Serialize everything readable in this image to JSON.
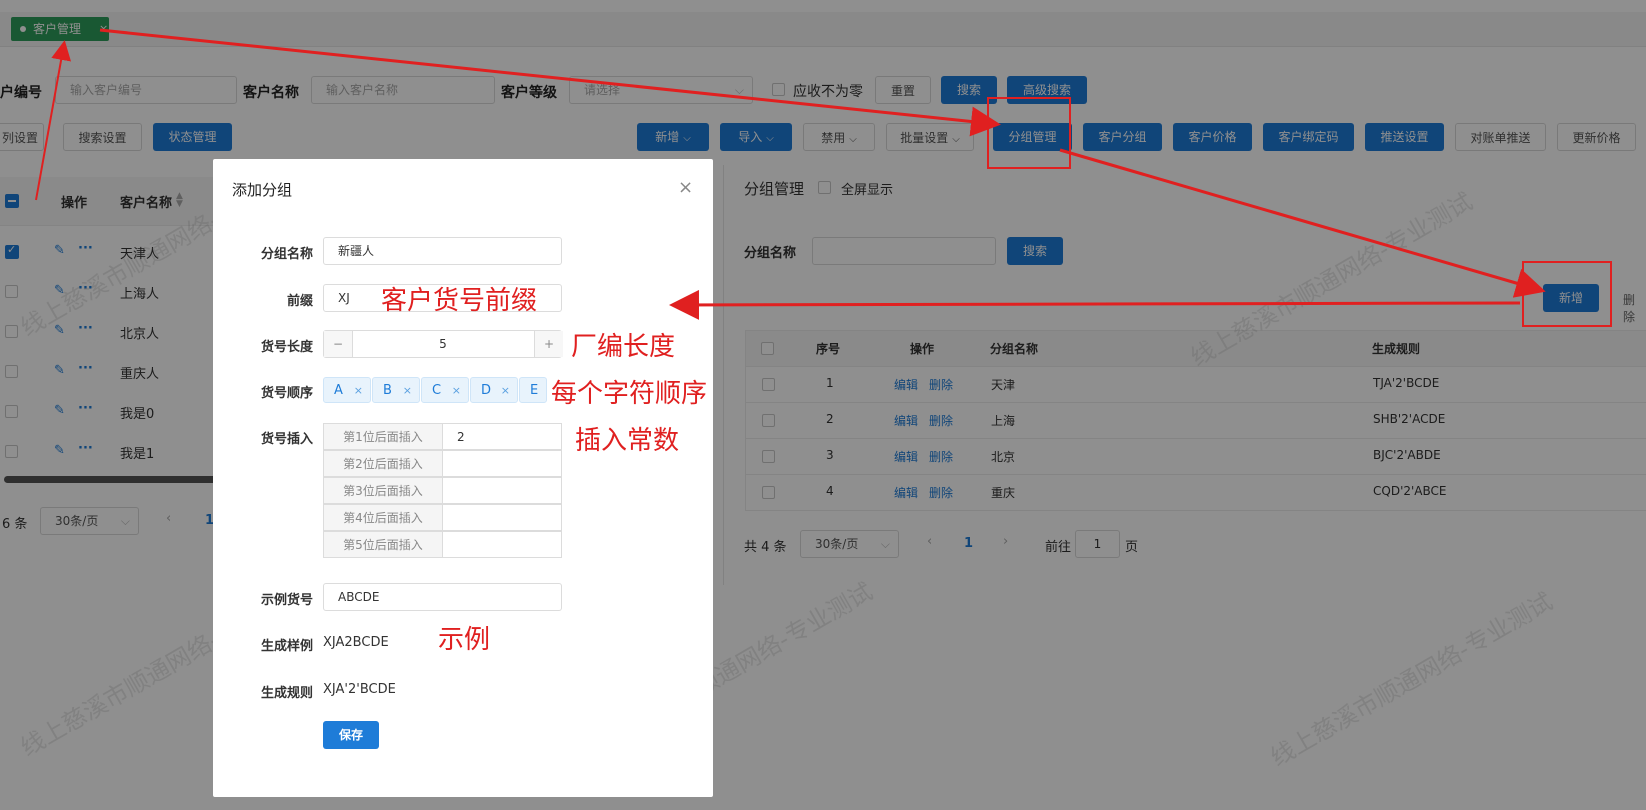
{
  "tab": {
    "label": "客户管理",
    "close": "×"
  },
  "filters": {
    "customer_no_label": "户编号",
    "customer_no_placeholder": "输入客户编号",
    "customer_name_label": "客户名称",
    "customer_name_placeholder": "输入客户名称",
    "customer_level_label": "客户等级",
    "customer_level_placeholder": "请选择",
    "receivable_nonzero_label": "应收不为零",
    "reset_label": "重置",
    "search_label": "搜索",
    "advanced_search_label": "高级搜索"
  },
  "toolbar": {
    "column_settings": "列设置",
    "search_settings": "搜索设置",
    "status_management": "状态管理",
    "add": "新增",
    "import": "导入",
    "disable": "禁用",
    "batch_settings": "批量设置",
    "group_management": "分组管理",
    "customer_group": "客户分组",
    "customer_price": "客户价格",
    "customer_bind_code": "客户绑定码",
    "push_settings": "推送设置",
    "statement_push": "对账单推送",
    "update_price": "更新价格"
  },
  "left_table": {
    "headers": {
      "ops": "操作",
      "name": "客户名称"
    },
    "rows": [
      {
        "name": "天津人",
        "checked": true
      },
      {
        "name": "上海人",
        "checked": false
      },
      {
        "name": "北京人",
        "checked": false
      },
      {
        "name": "重庆人",
        "checked": false
      },
      {
        "name": "我是0",
        "checked": false
      },
      {
        "name": "我是1",
        "checked": false
      }
    ],
    "total": "6 条",
    "page_size": "30条/页",
    "current_page": "1"
  },
  "group_panel": {
    "title": "分组管理",
    "fullscreen_label": "全屏显示",
    "name_label": "分组名称",
    "search_label": "搜索",
    "add_label": "新增",
    "delete_label": "删除",
    "headers": {
      "index": "序号",
      "ops": "操作",
      "name": "分组名称",
      "rule": "生成规则"
    },
    "rows": [
      {
        "index": "1",
        "edit": "编辑",
        "del": "删除",
        "name": "天津",
        "rule": "TJA'2'BCDE"
      },
      {
        "index": "2",
        "edit": "编辑",
        "del": "删除",
        "name": "上海",
        "rule": "SHB'2'ACDE"
      },
      {
        "index": "3",
        "edit": "编辑",
        "del": "删除",
        "name": "北京",
        "rule": "BJC'2'ABDE"
      },
      {
        "index": "4",
        "edit": "编辑",
        "del": "删除",
        "name": "重庆",
        "rule": "CQD'2'ABCE"
      }
    ],
    "total": "共 4 条",
    "page_size": "30条/页",
    "current_page": "1",
    "goto_label": "前往",
    "goto_value": "1",
    "page_suffix": "页"
  },
  "modal": {
    "title": "添加分组",
    "group_name_label": "分组名称",
    "group_name_value": "新疆人",
    "prefix_label": "前缀",
    "prefix_value": "XJ",
    "length_label": "货号长度",
    "length_value": "5",
    "order_label": "货号顺序",
    "order_tags": [
      "A",
      "B",
      "C",
      "D",
      "E"
    ],
    "insert_label": "货号插入",
    "inserts": [
      {
        "label": "第1位后面插入",
        "value": "2"
      },
      {
        "label": "第2位后面插入",
        "value": ""
      },
      {
        "label": "第3位后面插入",
        "value": ""
      },
      {
        "label": "第4位后面插入",
        "value": ""
      },
      {
        "label": "第5位后面插入",
        "value": ""
      }
    ],
    "example_no_label": "示例货号",
    "example_no_value": "ABCDE",
    "sample_label": "生成样例",
    "sample_value": "XJA2BCDE",
    "rule_label": "生成规则",
    "rule_value": "XJA'2'BCDE",
    "save_label": "保存"
  },
  "annotations": {
    "prefix": "客户货号前缀",
    "length": "厂编长度",
    "order": "每个字符顺序",
    "insert": "插入常数",
    "example": "示例"
  },
  "watermark": "线上慈溪市顺通网络-专业测试",
  "colors": {
    "primary": "#1e7cd8",
    "annotation": "#e02020",
    "tab_green": "#2e9e5b"
  }
}
